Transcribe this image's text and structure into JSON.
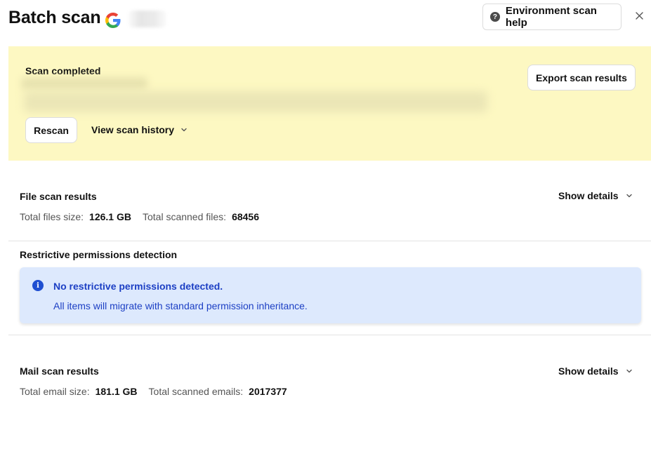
{
  "header": {
    "title": "Batch scan",
    "provider_icon": "google-icon",
    "help_button_label": "Environment scan help",
    "close_icon": "close-icon"
  },
  "scan_status": {
    "title": "Scan completed",
    "export_label": "Export scan results",
    "rescan_label": "Rescan",
    "history_label": "View scan history"
  },
  "file_scan": {
    "title": "File scan results",
    "show_details_label": "Show details",
    "size_label": "Total files size:",
    "size_value": "126.1 GB",
    "count_label": "Total scanned files:",
    "count_value": "68456"
  },
  "permissions": {
    "title": "Restrictive permissions detection",
    "info_title": "No restrictive permissions detected.",
    "info_body": "All items will migrate with standard permission inheritance."
  },
  "mail_scan": {
    "title": "Mail scan results",
    "show_details_label": "Show details",
    "size_label": "Total email size:",
    "size_value": "181.1 GB",
    "count_label": "Total scanned emails:",
    "count_value": "2017377"
  },
  "colors": {
    "status_bg": "#fdf8c2",
    "info_bg": "#dde9fd",
    "info_text": "#1c3fc4"
  }
}
